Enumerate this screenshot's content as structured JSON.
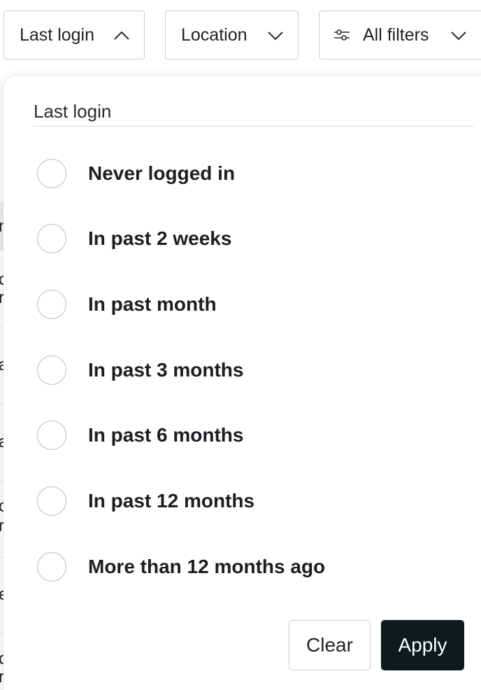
{
  "filters": {
    "last_login": {
      "label": "Last login",
      "expanded": true
    },
    "location": {
      "label": "Location"
    },
    "all_filters": {
      "label": "All filters"
    }
  },
  "dropdown": {
    "title": "Last login",
    "options": [
      {
        "label": "Never logged in",
        "selected": false
      },
      {
        "label": "In past 2 weeks",
        "selected": false
      },
      {
        "label": "In past month",
        "selected": false
      },
      {
        "label": "In past 3 months",
        "selected": false
      },
      {
        "label": "In past 6 months",
        "selected": false
      },
      {
        "label": "In past 12 months",
        "selected": false
      },
      {
        "label": "More than 12 months ago",
        "selected": false
      }
    ],
    "clear_label": "Clear",
    "apply_label": "Apply"
  },
  "background_list": {
    "fragments": [
      "n",
      "c",
      "r",
      "a",
      "a",
      "c",
      "r",
      "e",
      "c",
      "r,"
    ]
  },
  "colors": {
    "apply_bg": "#0e1a1b",
    "border": "#c9cbd1",
    "selected_row_bg": "#eceef3"
  }
}
